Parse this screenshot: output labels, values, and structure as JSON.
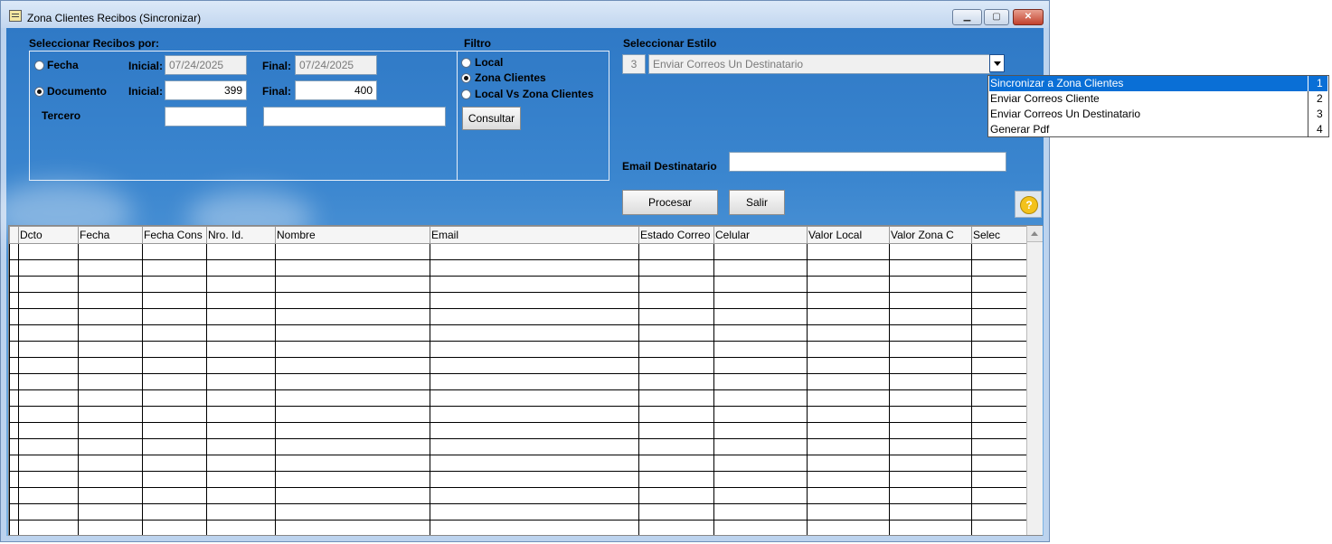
{
  "window": {
    "title": "Zona Clientes Recibos (Sincronizar)"
  },
  "seleccionar": {
    "heading": "Seleccionar Recibos por:",
    "fecha_label": "Fecha",
    "documento_label": "Documento",
    "tercero_label": "Tercero",
    "inicial_label": "Inicial:",
    "final_label": "Final:",
    "fecha_inicial": "07/24/2025",
    "fecha_final": "07/24/2025",
    "doc_inicial": "399",
    "doc_final": "400",
    "tercero_code": "",
    "tercero_name": "",
    "selected": "Documento"
  },
  "filtro": {
    "heading": "Filtro",
    "options": [
      "Local",
      "Zona Clientes",
      "Local Vs Zona Clientes"
    ],
    "selected": "Zona Clientes",
    "consultar_label": "Consultar"
  },
  "estilo": {
    "heading": "Seleccionar Estilo",
    "code": "3",
    "value": "Enviar Correos Un Destinatario",
    "dropdown": [
      {
        "name": "Sincronizar a Zona Clientes",
        "code": "1"
      },
      {
        "name": "Enviar Correos Cliente",
        "code": "2"
      },
      {
        "name": "Enviar Correos Un Destinatario",
        "code": "3"
      },
      {
        "name": "Generar Pdf",
        "code": "4"
      }
    ],
    "highlighted_index": 0
  },
  "email": {
    "label": "Email Destinatario",
    "value": ""
  },
  "actions": {
    "procesar": "Procesar",
    "salir": "Salir",
    "help": "?"
  },
  "grid": {
    "columns": [
      "Dcto",
      "Fecha",
      "Fecha Cons",
      "Nro. Id.",
      "Nombre",
      "Email",
      "Estado Correo",
      "Celular",
      "Valor Local",
      "Valor Zona C",
      "Selec"
    ],
    "rows": []
  }
}
